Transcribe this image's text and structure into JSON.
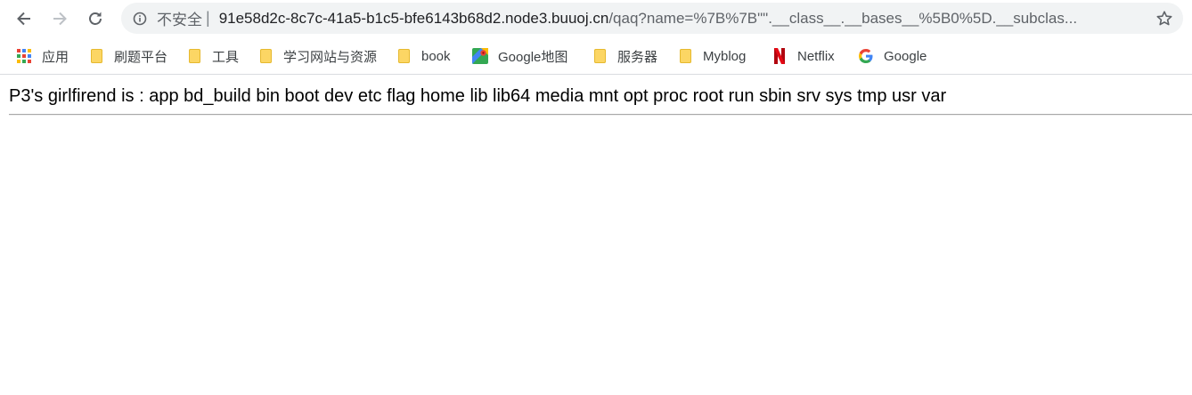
{
  "address_bar": {
    "security_label": "不安全",
    "separator": "|",
    "url_host": "91e58d2c-8c7c-41a5-b1c5-bfe6143b68d2.node3.buuoj.cn",
    "url_path": "/qaq?name=%7B%7B\"\".__class__.__bases__%5B0%5D.__subclas..."
  },
  "bookmarks": [
    {
      "label": "应用",
      "icon": "apps-grid-icon"
    },
    {
      "label": "刷题平台",
      "icon": "folder-icon"
    },
    {
      "label": "工具",
      "icon": "folder-icon"
    },
    {
      "label": "学习网站与资源",
      "icon": "folder-icon"
    },
    {
      "label": "book",
      "icon": "folder-icon"
    },
    {
      "label": "Google地图",
      "icon": "google-maps-icon"
    },
    {
      "label": "服务器",
      "icon": "folder-icon"
    },
    {
      "label": "Myblog",
      "icon": "folder-icon"
    },
    {
      "label": "Netflix",
      "icon": "netflix-icon"
    },
    {
      "label": "Google",
      "icon": "google-icon"
    }
  ],
  "page": {
    "text": "P3's girlfirend is : app bd_build bin boot dev etc flag home lib lib64 media mnt opt proc root run sbin srv sys tmp usr var"
  }
}
